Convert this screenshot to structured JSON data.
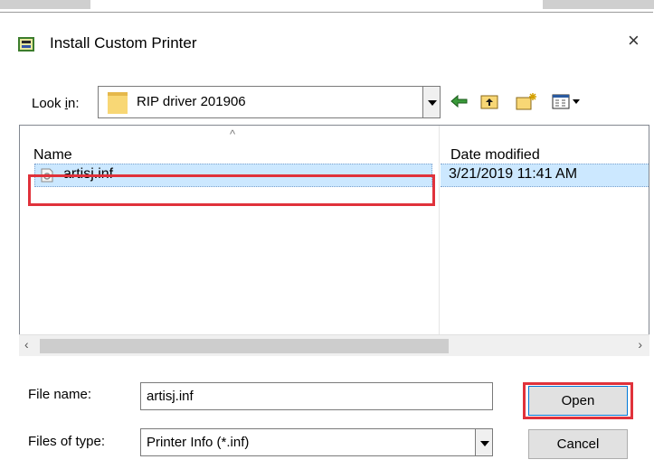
{
  "dialog": {
    "title": "Install Custom Printer",
    "close_glyph": "×"
  },
  "look_in": {
    "label_prefix": "Look ",
    "label_mnemonic": "i",
    "label_suffix": "n:",
    "value": "RIP driver 201906"
  },
  "toolbar": {
    "icons": [
      "back-arrow-icon",
      "up-folder-icon",
      "new-folder-icon",
      "view-menu-icon"
    ]
  },
  "file_list": {
    "sort_glyph": "^",
    "columns": [
      "Name",
      "Date modified"
    ],
    "rows": [
      {
        "name": "artisj.inf",
        "date_modified": "3/21/2019 11:41 AM",
        "icon": "inf-file-icon",
        "selected": true
      }
    ]
  },
  "scrollbar": {
    "left_arrow": "‹",
    "right_arrow": "›"
  },
  "file_name": {
    "label": "File name:",
    "value": "artisj.inf"
  },
  "file_type": {
    "label": "Files of type:",
    "value": "Printer Info (*.inf)"
  },
  "buttons": {
    "open": "Open",
    "cancel": "Cancel"
  },
  "colors": {
    "highlight_box": "#e0323b",
    "selection": "#cce8ff",
    "folder": "#f8d775"
  }
}
